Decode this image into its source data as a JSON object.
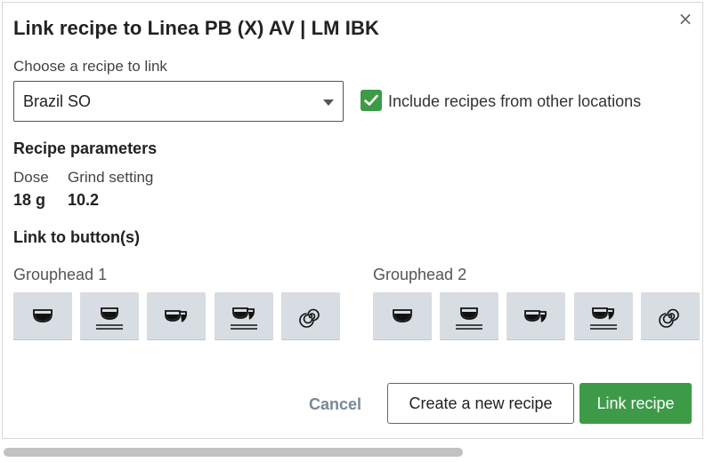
{
  "dialog": {
    "title": "Link recipe to Linea PB (X) AV | LM IBK",
    "close_symbol": "×"
  },
  "recipe_select": {
    "label": "Choose a recipe to link",
    "value": "Brazil SO"
  },
  "include_other_locations": {
    "label": "Include recipes from other locations",
    "checked": true
  },
  "parameters": {
    "heading": "Recipe parameters",
    "dose_label": "Dose",
    "dose_value": "18 g",
    "grind_label": "Grind setting",
    "grind_value": "10.2"
  },
  "link_buttons": {
    "heading": "Link to button(s)",
    "groupheads": [
      {
        "label": "Grouphead 1",
        "buttons": [
          "single-cup-icon",
          "single-cup-scale-icon",
          "double-cup-icon",
          "double-cup-scale-icon",
          "continuous-flow-icon"
        ]
      },
      {
        "label": "Grouphead 2",
        "buttons": [
          "single-cup-icon",
          "single-cup-scale-icon",
          "double-cup-icon",
          "double-cup-scale-icon",
          "continuous-flow-icon"
        ]
      }
    ]
  },
  "actions": {
    "cancel": "Cancel",
    "create": "Create a new recipe",
    "link": "Link recipe"
  },
  "colors": {
    "accent_green": "#3d9b47",
    "button_gray": "#d7dde2"
  }
}
